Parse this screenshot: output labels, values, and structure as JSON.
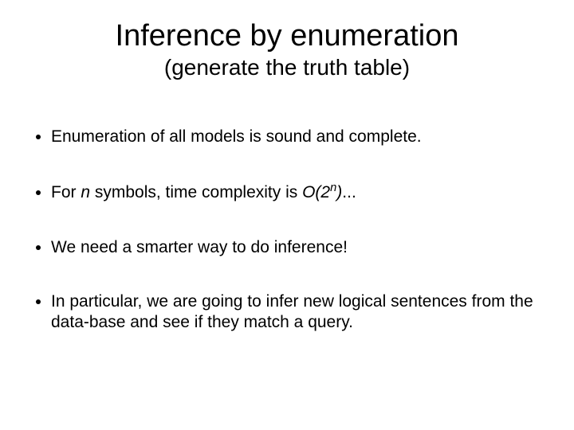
{
  "title": "Inference by enumeration",
  "subtitle": "(generate the truth table)",
  "bullets": {
    "b1": "Enumeration of all models is sound and complete.",
    "b2_pre": "For ",
    "b2_n": "n",
    "b2_mid": " symbols, time complexity is ",
    "b2_bigO": "O(2",
    "b2_exp": "n",
    "b2_close": ")",
    "b2_post": "...",
    "b3": "We need a smarter way to do inference!",
    "b4": "In particular, we are going to infer new logical sentences from the data-base and see if they match a query."
  }
}
